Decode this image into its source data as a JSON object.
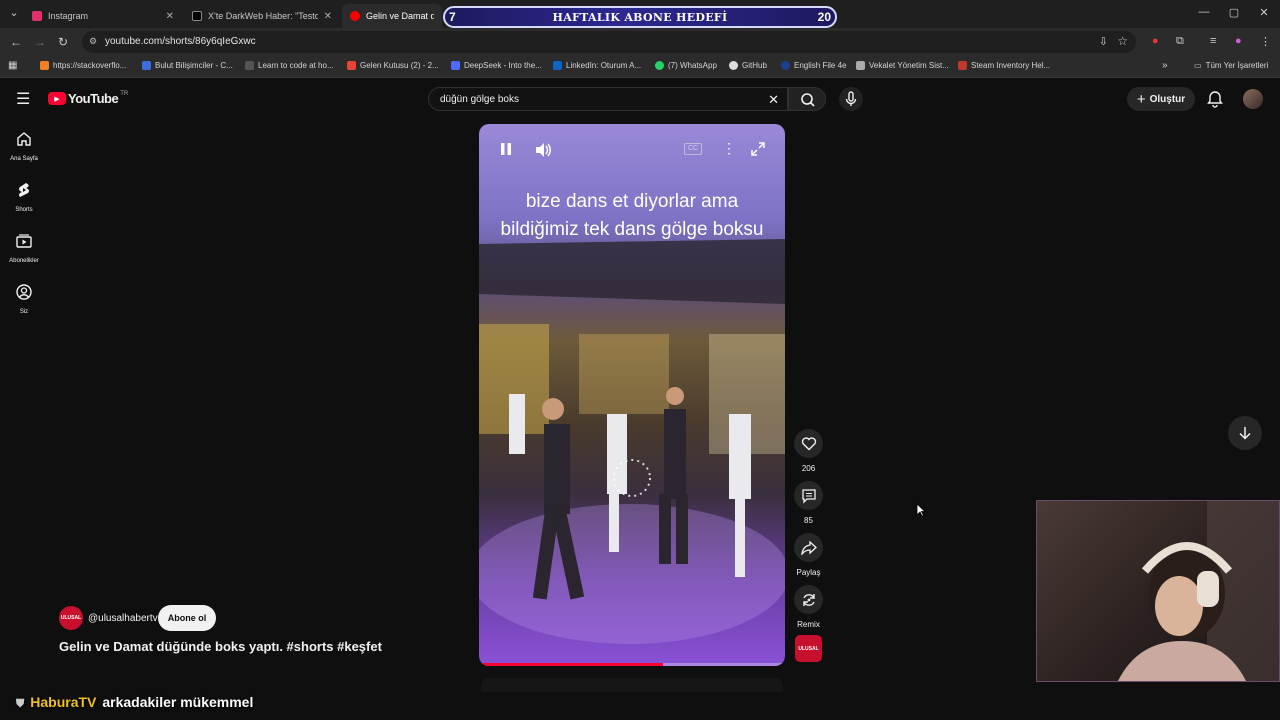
{
  "browser": {
    "tabs": [
      {
        "title": "Instagram",
        "color": "#e1306c"
      },
      {
        "title": "X'te DarkWeb Haber: \"Testo Ta",
        "color": "#000000"
      },
      {
        "title": "Gelin ve Damat düğün",
        "color": "#ff0000"
      }
    ],
    "url": "youtube.com/shorts/86y6qIeGxwc",
    "bookmarks": [
      "https://stackoverflo...",
      "Bulut Bilişimciler - C...",
      "Learn to code at ho...",
      "Gelen Kutusu (2) - 2...",
      "DeepSeek - Into the...",
      "LinkedIn: Oturum A...",
      "(7) WhatsApp",
      "GitHub",
      "English File 4e",
      "Vekalet Yönetim Sist...",
      "Steam Inventory Hel..."
    ],
    "all_bookmarks": "Tüm Yer İşaretleri"
  },
  "goal_overlay": {
    "current": "7",
    "title": "HAFTALIK ABONE HEDEFİ",
    "target": "20"
  },
  "youtube": {
    "logo": "YouTube",
    "region": "TR",
    "search_query": "düğün gölge boks",
    "create_label": "Oluştur",
    "nav": [
      {
        "label": "Ana Sayfa",
        "icon": "home-icon"
      },
      {
        "label": "Shorts",
        "icon": "shorts-icon"
      },
      {
        "label": "Abonelikler",
        "icon": "subscriptions-icon"
      },
      {
        "label": "Siz",
        "icon": "you-icon"
      }
    ]
  },
  "video": {
    "caption": "bize dans et diyorlar ama bildiğimiz tek dans gölge boksu",
    "progress": 0.6,
    "likes": "206",
    "comments": "85",
    "share_label": "Paylaş",
    "remix_label": "Remix"
  },
  "channel": {
    "handle": "@ulusalhabertv",
    "avatar_text": "ULUSAL",
    "subscribe_label": "Abone ol",
    "title": "Gelin ve Damat düğünde boks yaptı. #shorts #keşfet"
  },
  "chat": {
    "user": "HaburaTV",
    "message": "arkadakiler mükemmel"
  }
}
